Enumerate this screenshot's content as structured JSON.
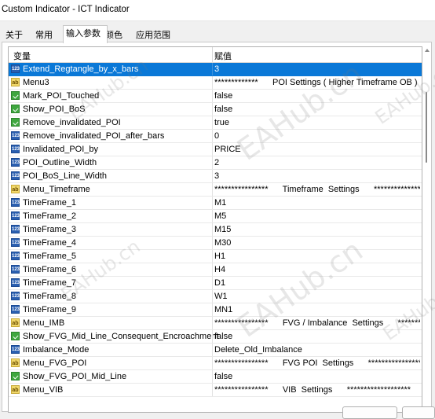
{
  "window": {
    "title": "Custom Indicator - ICT Indicator"
  },
  "tabs": [
    {
      "label": "关于"
    },
    {
      "label": "常用"
    },
    {
      "label": "输入参数"
    },
    {
      "label": "颜色"
    },
    {
      "label": "应用范围"
    }
  ],
  "grid": {
    "headers": {
      "variable": "变量",
      "value": "赋值"
    },
    "rows": [
      {
        "icon": "num",
        "name": "Extend_Regtangle_by_x_bars",
        "value": "3"
      },
      {
        "icon": "str",
        "name": "Menu3",
        "value": "*************      POI Settings ( Higher Timeframe OB ) ..."
      },
      {
        "icon": "bool",
        "name": "Mark_POI_Touched",
        "value": "false"
      },
      {
        "icon": "bool",
        "name": "Show_POI_BoS",
        "value": "false"
      },
      {
        "icon": "bool",
        "name": "Remove_invalidated_POI",
        "value": "true"
      },
      {
        "icon": "num",
        "name": "Remove_invalidated_POI_after_bars",
        "value": "0"
      },
      {
        "icon": "num",
        "name": "Invalidated_POI_by",
        "value": "PRICE"
      },
      {
        "icon": "num",
        "name": "POI_Outline_Width",
        "value": "2"
      },
      {
        "icon": "num",
        "name": "POI_BoS_Line_Width",
        "value": "3"
      },
      {
        "icon": "str",
        "name": "Menu_Timeframe",
        "value": "****************      Timeframe  Settings      ***************..."
      },
      {
        "icon": "num",
        "name": "TimeFrame_1",
        "value": "M1"
      },
      {
        "icon": "num",
        "name": "TimeFrame_2",
        "value": "M5"
      },
      {
        "icon": "num",
        "name": "TimeFrame_3",
        "value": "M15"
      },
      {
        "icon": "num",
        "name": "TimeFrame_4",
        "value": "M30"
      },
      {
        "icon": "num",
        "name": "TimeFrame_5",
        "value": "H1"
      },
      {
        "icon": "num",
        "name": "TimeFrame_6",
        "value": "H4"
      },
      {
        "icon": "num",
        "name": "TimeFrame_7",
        "value": "D1"
      },
      {
        "icon": "num",
        "name": "TimeFrame_8",
        "value": "W1"
      },
      {
        "icon": "num",
        "name": "TimeFrame_9",
        "value": "MN1"
      },
      {
        "icon": "str",
        "name": "Menu_IMB",
        "value": "****************      FVG / Imbalance  Settings      ********..."
      },
      {
        "icon": "bool",
        "name": "Show_FVG_Mid_Line_Consequent_Encroachment",
        "value": "false"
      },
      {
        "icon": "num",
        "name": "Imbalance_Mode",
        "value": "Delete_Old_Imbalance"
      },
      {
        "icon": "str",
        "name": "Menu_FVG_POI",
        "value": "****************      FVG POI  Settings      ********************"
      },
      {
        "icon": "bool",
        "name": "Show_FVG_POI_Mid_Line",
        "value": "false"
      },
      {
        "icon": "str",
        "name": "Menu_VIB",
        "value": "****************      VIB  Settings      *******************"
      }
    ]
  },
  "watermark": {
    "text": "EAHub.cn"
  },
  "colors": {
    "selection": "#0a78d7"
  }
}
